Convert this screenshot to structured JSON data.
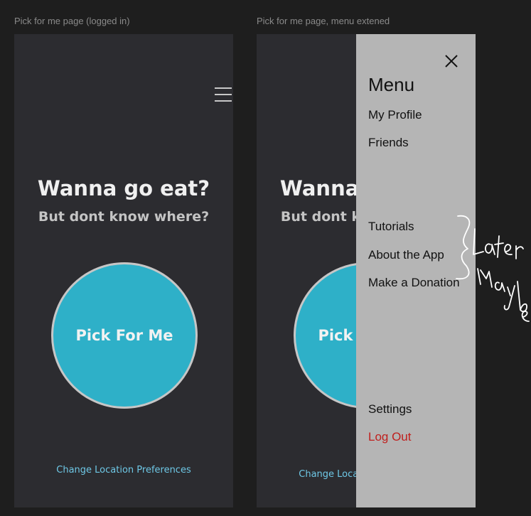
{
  "frames": [
    {
      "label": "Pick for me page (logged in)",
      "headline": "Wanna go eat?",
      "subline": "But dont know where?",
      "pick_button_label": "Pick For Me",
      "location_link": "Change Location Preferences"
    },
    {
      "label": "Pick for me page, menu extened",
      "headline": "Wanna go eat?",
      "subline": "But dont know where?",
      "pick_button_label": "Pick For Me",
      "location_link": "Change Location Preferences"
    }
  ],
  "menu": {
    "title": "Menu",
    "items": [
      "My Profile",
      "Friends",
      "Tutorials",
      "About the App",
      "Make a Donation",
      "Settings",
      "Log Out"
    ]
  },
  "annotation": {
    "text": "Later Maybe"
  },
  "colors": {
    "background": "#1e1e1e",
    "frame": "#2c2c30",
    "button": "#2eb0c8",
    "menu_panel": "#b5b5b5",
    "logout": "#c0201e",
    "link": "#6ec8e6"
  }
}
